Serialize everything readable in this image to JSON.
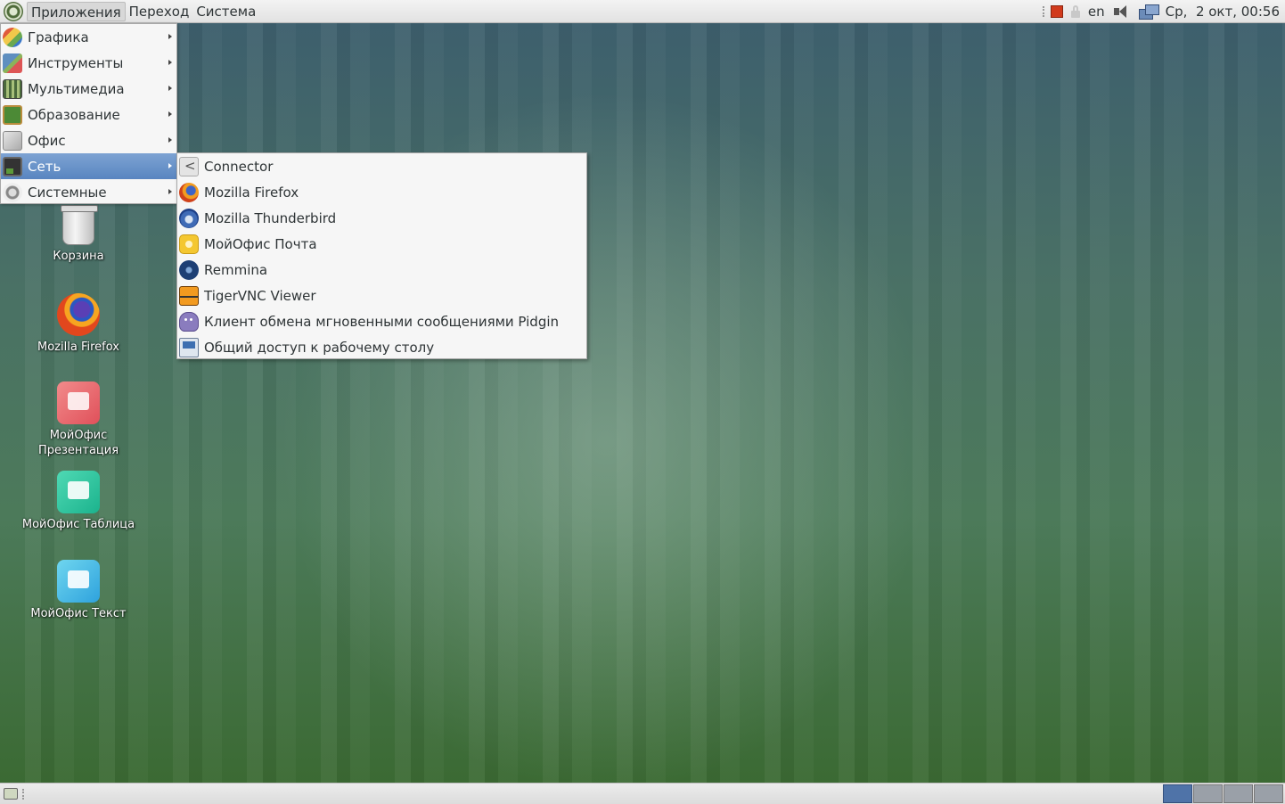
{
  "top_panel": {
    "menus": [
      "Приложения",
      "Переход",
      "Система"
    ],
    "keyboard_layout": "en",
    "clock": "Ср,  2 окт, 00:56"
  },
  "app_menu": {
    "items": [
      {
        "label": "Графика",
        "icon": "graphics-icon"
      },
      {
        "label": "Инструменты",
        "icon": "tools-icon"
      },
      {
        "label": "Мультимедиа",
        "icon": "multimedia-icon"
      },
      {
        "label": "Образование",
        "icon": "education-icon"
      },
      {
        "label": "Офис",
        "icon": "office-icon"
      },
      {
        "label": "Сеть",
        "icon": "network-icon",
        "selected": true
      },
      {
        "label": "Системные",
        "icon": "system-icon"
      }
    ]
  },
  "network_submenu": {
    "items": [
      {
        "label": "Connector",
        "icon": "connector-icon"
      },
      {
        "label": "Mozilla Firefox",
        "icon": "firefox-icon"
      },
      {
        "label": "Mozilla Thunderbird",
        "icon": "thunderbird-icon"
      },
      {
        "label": "МойОфис Почта",
        "icon": "myoffice-mail-icon"
      },
      {
        "label": "Remmina",
        "icon": "remmina-icon"
      },
      {
        "label": "TigerVNC Viewer",
        "icon": "tigervnc-icon"
      },
      {
        "label": "Клиент обмена мгновенными сообщениями Pidgin",
        "icon": "pidgin-icon"
      },
      {
        "label": "Общий доступ к рабочему столу",
        "icon": "desktop-share-icon"
      }
    ]
  },
  "desktop_icons": [
    {
      "label": "Корзина",
      "icon": "trash-icon"
    },
    {
      "label": "Mozilla Firefox",
      "icon": "firefox-icon"
    },
    {
      "label_line1": "МойОфис",
      "label_line2": "Презентация",
      "icon": "myoffice-presentation-icon"
    },
    {
      "label": "МойОфис Таблица",
      "icon": "myoffice-table-icon"
    },
    {
      "label": "МойОфис Текст",
      "icon": "myoffice-text-icon"
    }
  ],
  "bottom_panel": {
    "workspace_count": 4,
    "active_workspace": 1
  },
  "colors": {
    "menu_highlight": "#5985c0",
    "active_workspace": "#4f73a8"
  }
}
